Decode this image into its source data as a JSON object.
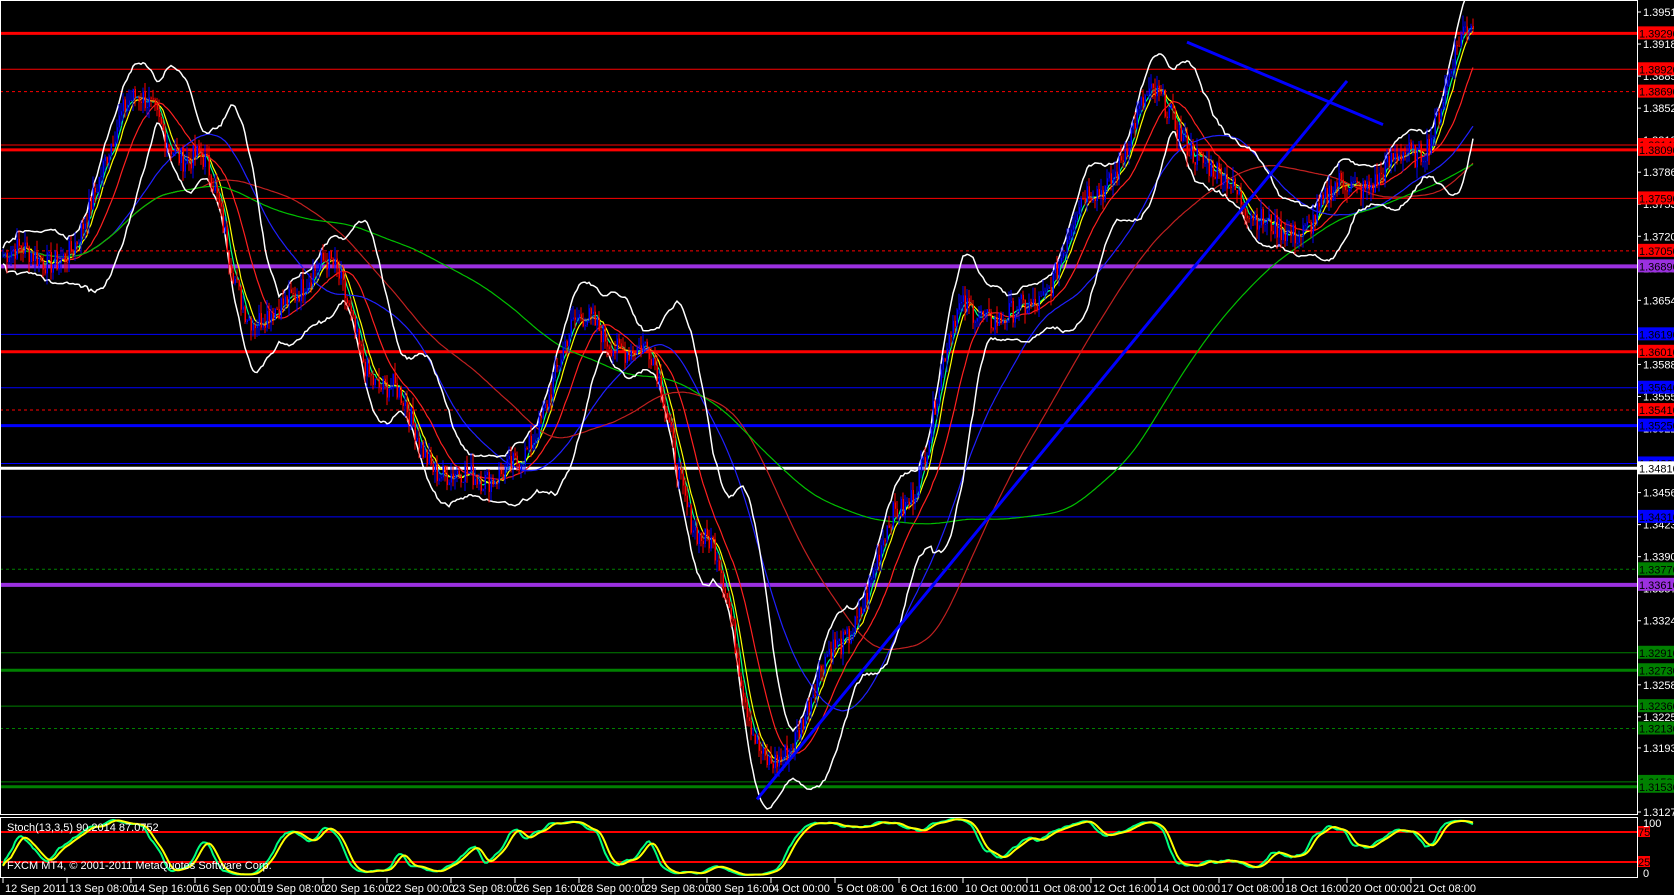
{
  "window": {
    "copyright": "FXCM MT4, © 2001-2011 MetaQuotes Software Corp."
  },
  "indicator": {
    "label": "Stoch(13,3,5) 90.2014 87.0752",
    "levels": [
      75,
      25
    ],
    "scale": [
      "100",
      "0"
    ],
    "level_labels": [
      "75",
      "25"
    ]
  },
  "colors": {
    "background": "#000000",
    "bull": "#0000ff",
    "bear": "#ff0000",
    "axis": "#ffffff",
    "stoch_main": "#00ff7f",
    "stoch_signal": "#ffff00"
  },
  "chart_data": {
    "type": "candlestick",
    "symbol_timeframe": "H1",
    "ylim": [
      1.3127,
      1.3951
    ],
    "price_ticks": [
      "1.39510",
      "1.39180",
      "1.38850",
      "1.38520",
      "1.38190",
      "1.37860",
      "1.37530",
      "1.37200",
      "1.36870",
      "1.36540",
      "1.36210",
      "1.35880",
      "1.35550",
      "1.35220",
      "1.34890",
      "1.34560",
      "1.34230",
      "1.33900",
      "1.33570",
      "1.33240",
      "1.32910",
      "1.32580",
      "1.32250",
      "1.31930",
      "1.31600",
      "1.31270"
    ],
    "time_labels": [
      "12 Sep 2011",
      "13 Sep 08:00",
      "14 Sep 16:00",
      "16 Sep 00:00",
      "19 Sep 08:00",
      "20 Sep 16:00",
      "22 Sep 00:00",
      "23 Sep 08:00",
      "26 Sep 16:00",
      "28 Sep 00:00",
      "29 Sep 08:00",
      "30 Sep 16:00",
      "4 Oct 00:00",
      "5 Oct 08:00",
      "6 Oct 16:00",
      "10 Oct 00:00",
      "11 Oct 08:00",
      "12 Oct 16:00",
      "14 Oct 00:00",
      "17 Oct 08:00",
      "18 Oct 16:00",
      "20 Oct 00:00",
      "21 Oct 08:00"
    ],
    "bars_per_label": 32,
    "close_keypoints": [
      1.37,
      1.37,
      1.386,
      1.38,
      1.363,
      1.369,
      1.356,
      1.347,
      1.348,
      1.363,
      1.36,
      1.34,
      1.317,
      1.329,
      1.343,
      1.364,
      1.364,
      1.376,
      1.386,
      1.378,
      1.372,
      1.377,
      1.38,
      1.3935
    ],
    "levels": [
      {
        "price": "1.39290",
        "color": "#ff0000",
        "width": 3,
        "dash": false,
        "label_bg": "#ff0000"
      },
      {
        "price": "1.38920",
        "color": "#ff0000",
        "width": 1,
        "dash": false,
        "label_bg": "#ff0000"
      },
      {
        "price": "1.38690",
        "color": "#ff0000",
        "width": 1,
        "dash": true,
        "label_bg": "#ff0000"
      },
      {
        "price": "1.38140",
        "color": "#ff0000",
        "width": 1,
        "dash": false,
        "label_bg": "#ff0000"
      },
      {
        "price": "1.38090",
        "color": "#ff0000",
        "width": 3,
        "dash": false,
        "label_bg": "#ff0000"
      },
      {
        "price": "1.37590",
        "color": "#ff0000",
        "width": 1,
        "dash": false,
        "label_bg": "#ff0000"
      },
      {
        "price": "1.37050",
        "color": "#ff0000",
        "width": 1,
        "dash": true,
        "label_bg": "#ff0000"
      },
      {
        "price": "1.36890",
        "color": "#9b30e0",
        "width": 4,
        "dash": false,
        "label_bg": "#9b30e0"
      },
      {
        "price": "1.36190",
        "color": "#0000ff",
        "width": 1,
        "dash": false,
        "label_bg": "#0000ff"
      },
      {
        "price": "1.36010",
        "color": "#ff0000",
        "width": 3,
        "dash": false,
        "label_bg": "#ff0000"
      },
      {
        "price": "1.35640",
        "color": "#0000ff",
        "width": 1,
        "dash": false,
        "label_bg": "#0000ff"
      },
      {
        "price": "1.35410",
        "color": "#ff0000",
        "width": 1,
        "dash": true,
        "label_bg": "#ff0000"
      },
      {
        "price": "1.35250",
        "color": "#0000ff",
        "width": 3,
        "dash": false,
        "label_bg": "#0000ff"
      },
      {
        "price": "1.34860",
        "color": "#0000ff",
        "width": 1,
        "dash": false,
        "label_bg": "#0000ff"
      },
      {
        "price": "1.34810",
        "color": "#ffffff",
        "width": 3,
        "dash": false,
        "label_bg": "#ffffff"
      },
      {
        "price": "1.34310",
        "color": "#0000ff",
        "width": 1,
        "dash": false,
        "label_bg": "#0000ff"
      },
      {
        "price": "1.33770",
        "color": "#008000",
        "width": 1,
        "dash": true,
        "label_bg": "#008000"
      },
      {
        "price": "1.33610",
        "color": "#9b30e0",
        "width": 4,
        "dash": false,
        "label_bg": "#9b30e0"
      },
      {
        "price": "1.32910",
        "color": "#008000",
        "width": 1,
        "dash": false,
        "label_bg": "#008000"
      },
      {
        "price": "1.32730",
        "color": "#008000",
        "width": 3,
        "dash": false,
        "label_bg": "#008000"
      },
      {
        "price": "1.32360",
        "color": "#008000",
        "width": 1,
        "dash": false,
        "label_bg": "#008000"
      },
      {
        "price": "1.32130",
        "color": "#008000",
        "width": 1,
        "dash": true,
        "label_bg": "#008000"
      },
      {
        "price": "1.31580",
        "color": "#008000",
        "width": 1,
        "dash": false,
        "label_bg": "#008000"
      },
      {
        "price": "1.31530",
        "color": "#008000",
        "width": 3,
        "dash": false,
        "label_bg": "#008000"
      }
    ],
    "trendlines": [
      {
        "from": [
          377,
          1.314
        ],
        "to": [
          672,
          1.388
        ],
        "color": "#0000ff"
      },
      {
        "from": [
          592,
          1.392
        ],
        "to": [
          690,
          1.3835
        ],
        "color": "#0000ff"
      }
    ],
    "moving_averages": [
      {
        "period": 5,
        "color": "#00ff7f"
      },
      {
        "period": 8,
        "color": "#ffff00"
      },
      {
        "period": 21,
        "color": "#ff2020"
      },
      {
        "period": 55,
        "color": "#2020ff"
      },
      {
        "period": 100,
        "color": "#c02020"
      },
      {
        "period": 200,
        "color": "#00c000"
      }
    ],
    "bollinger": {
      "period": 20,
      "deviation": 2,
      "color": "#ffffff"
    },
    "stochastic": {
      "k": 90.2014,
      "d": 87.0752
    }
  }
}
